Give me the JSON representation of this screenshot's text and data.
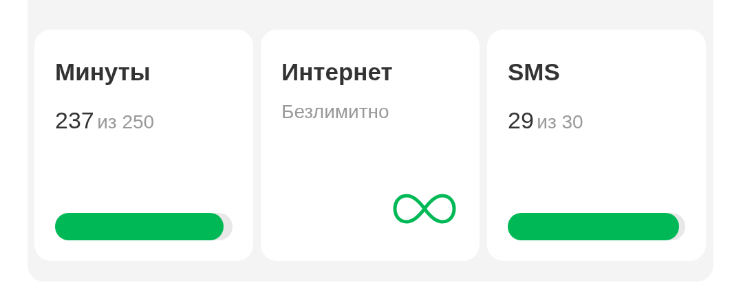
{
  "packages": [
    {
      "kind": "meter",
      "title": "Минуты",
      "used": "237",
      "separator_total": "из 250",
      "level": 0.948
    },
    {
      "kind": "unlimited",
      "title": "Интернет",
      "note": "Безлимитно"
    },
    {
      "kind": "meter",
      "title": "SMS",
      "used": "29",
      "separator_total": "из 30",
      "level": 0.967
    }
  ]
}
